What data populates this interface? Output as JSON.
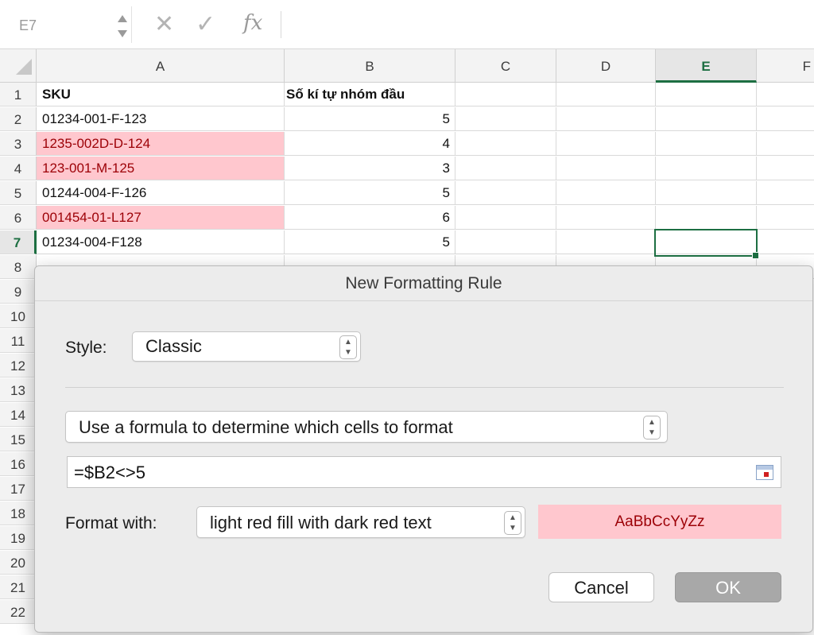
{
  "name_box": {
    "value": "E7"
  },
  "formula_bar": {
    "fx_label": "fx",
    "cancel_glyph": "✕",
    "enter_glyph": "✓"
  },
  "columns": [
    "A",
    "B",
    "C",
    "D",
    "E",
    "F"
  ],
  "active_column": "E",
  "row_numbers": [
    "1",
    "2",
    "3",
    "4",
    "5",
    "6",
    "7",
    "8",
    "9",
    "10",
    "11",
    "12",
    "13",
    "14",
    "15",
    "16",
    "17",
    "18",
    "19",
    "20",
    "21",
    "22"
  ],
  "active_row": "7",
  "sheet": {
    "header": {
      "a": "SKU",
      "b": "Số kí tự nhóm đầu"
    },
    "rows": [
      {
        "a": "01234-001-F-123",
        "b": "5",
        "highlighted": false
      },
      {
        "a": "1235-002D-D-124",
        "b": "4",
        "highlighted": true
      },
      {
        "a": "123-001-M-125",
        "b": "3",
        "highlighted": true
      },
      {
        "a": "01244-004-F-126",
        "b": "5",
        "highlighted": false
      },
      {
        "a": "001454-01-L127",
        "b": "6",
        "highlighted": true
      },
      {
        "a": "01234-004-F128",
        "b": "5",
        "highlighted": false
      }
    ]
  },
  "dialog": {
    "title": "New Formatting Rule",
    "style_label": "Style:",
    "style_value": "Classic",
    "rule_type_value": "Use a formula to determine which cells to format",
    "formula_value": "=$B2<>5",
    "format_with_label": "Format with:",
    "format_with_value": "light red fill with dark red text",
    "preview_text": "AaBbCcYyZz",
    "cancel_label": "Cancel",
    "ok_label": "OK"
  },
  "colors": {
    "accent_green": "#1d6f42",
    "highlight_fill": "#ffc7ce",
    "highlight_text": "#9c0006"
  },
  "icons": [
    "stepper-icon",
    "cancel-icon",
    "enter-icon",
    "fx-icon",
    "popup-arrows-icon",
    "range-select-icon"
  ]
}
